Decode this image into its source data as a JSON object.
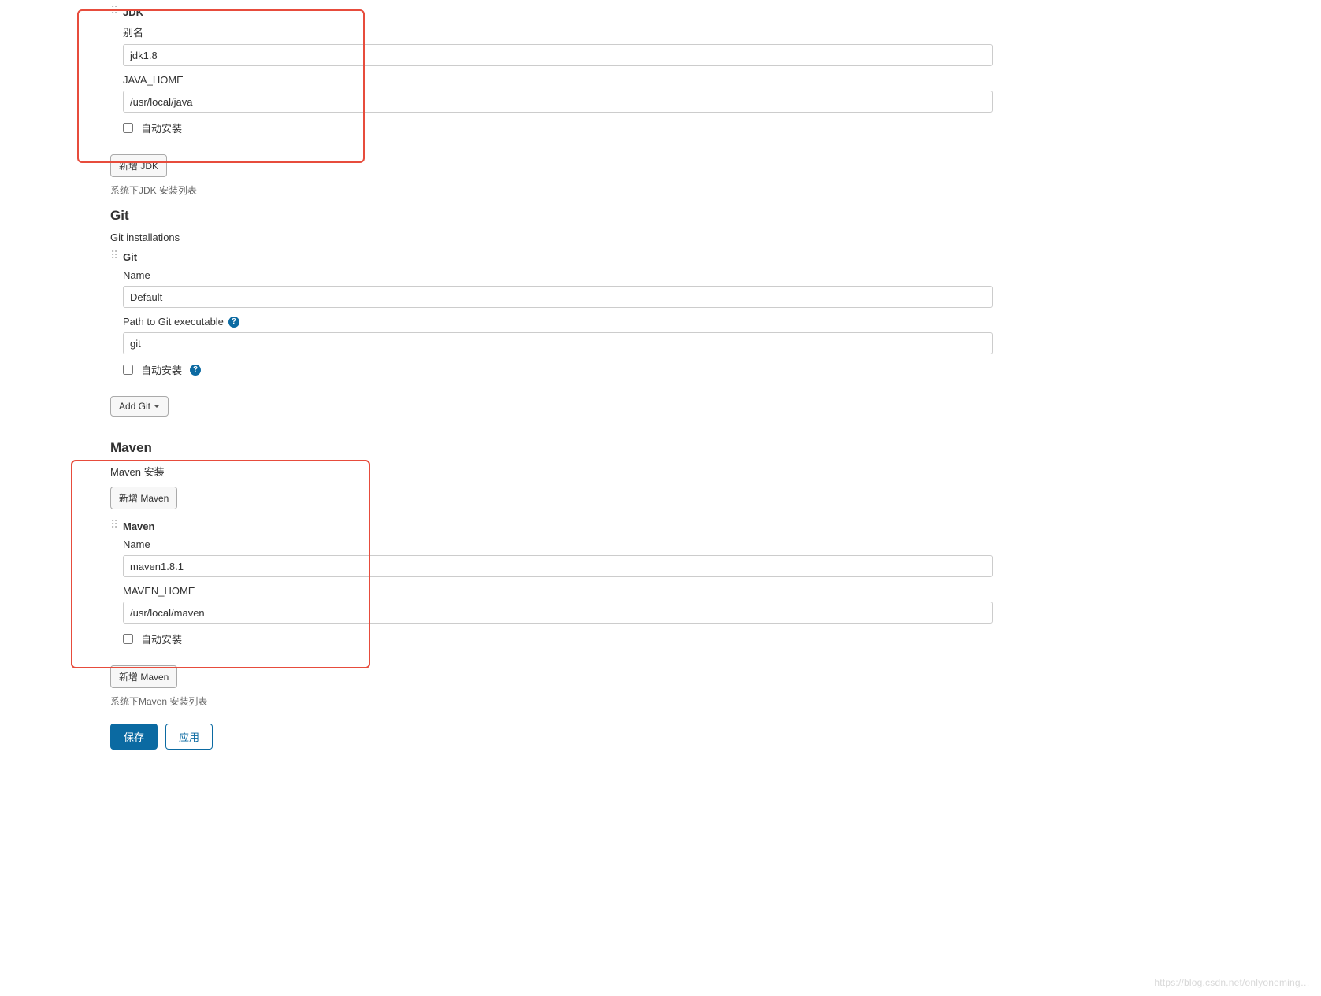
{
  "jdk": {
    "title": "JDK",
    "alias_label": "别名",
    "alias_value": "jdk1.8",
    "home_label": "JAVA_HOME",
    "home_value": "/usr/local/java",
    "auto_install_label": "自动安装",
    "add_button": "新增 JDK",
    "list_note": "系统下JDK 安装列表"
  },
  "git": {
    "section_title": "Git",
    "installations_label": "Git installations",
    "tool_title": "Git",
    "name_label": "Name",
    "name_value": "Default",
    "path_label": "Path to Git executable",
    "path_value": "git",
    "auto_install_label": "自动安装",
    "add_button": "Add Git"
  },
  "maven": {
    "section_title": "Maven",
    "install_label": "Maven 安装",
    "add_button_top": "新增 Maven",
    "tool_title": "Maven",
    "name_label": "Name",
    "name_value": "maven1.8.1",
    "home_label": "MAVEN_HOME",
    "home_value": "/usr/local/maven",
    "auto_install_label": "自动安装",
    "add_button_bottom": "新增 Maven",
    "list_note": "系统下Maven 安装列表"
  },
  "actions": {
    "save": "保存",
    "apply": "应用"
  },
  "watermark": "https://blog.csdn.net/onlyoneming…",
  "colors": {
    "accent": "#0b6aa2",
    "highlight_box": "#e74c3c"
  }
}
